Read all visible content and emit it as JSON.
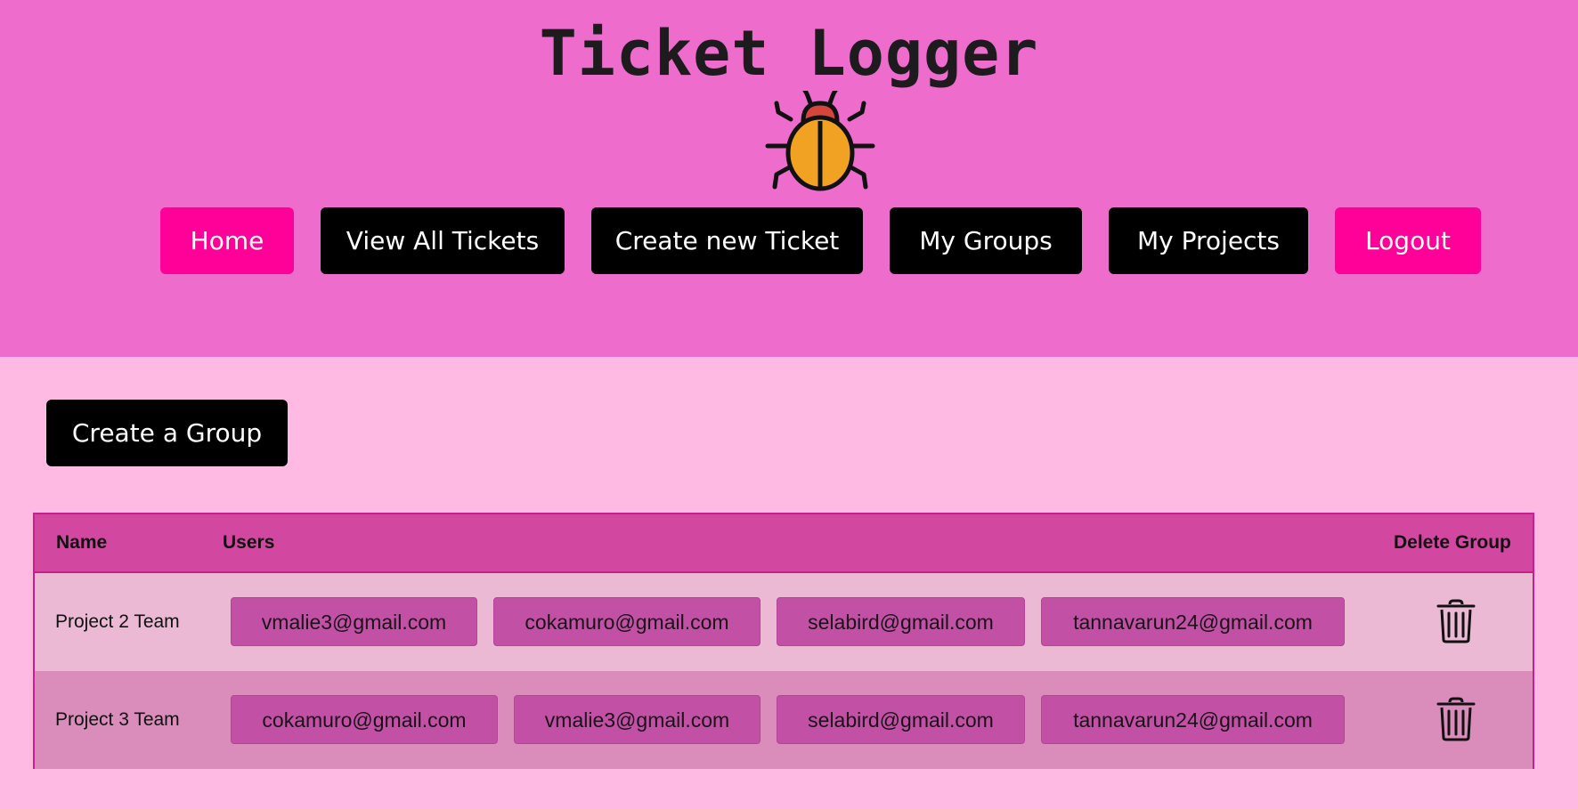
{
  "app": {
    "title": "Ticket Logger",
    "logo_icon": "bug-icon"
  },
  "nav": {
    "items": [
      {
        "label": "Home",
        "color": "#ff0098"
      },
      {
        "label": "View All Tickets",
        "color": "#000000"
      },
      {
        "label": "Create new Ticket",
        "color": "#000000"
      },
      {
        "label": "My Groups",
        "color": "#000000"
      },
      {
        "label": "My Projects",
        "color": "#000000"
      },
      {
        "label": "Logout",
        "color": "#ff0098"
      }
    ]
  },
  "page": {
    "create_group_label": "Create a Group"
  },
  "table": {
    "headers": {
      "name": "Name",
      "users": "Users",
      "delete": "Delete Group"
    },
    "rows": [
      {
        "name": "Project 2 Team",
        "users": [
          "vmalie3@gmail.com",
          "cokamuro@gmail.com",
          "selabird@gmail.com",
          "tannavarun24@gmail.com"
        ],
        "delete_icon": "trash-icon"
      },
      {
        "name": "Project 3 Team",
        "users": [
          "cokamuro@gmail.com",
          "vmalie3@gmail.com",
          "selabird@gmail.com",
          "tannavarun24@gmail.com"
        ],
        "delete_icon": "trash-icon"
      }
    ]
  },
  "colors": {
    "header_bg": "#ee6ccc",
    "page_bg": "#ffbae4",
    "accent_pink": "#ff0098",
    "table_header_bg": "#d2479f",
    "chip_bg": "#c251a6"
  }
}
